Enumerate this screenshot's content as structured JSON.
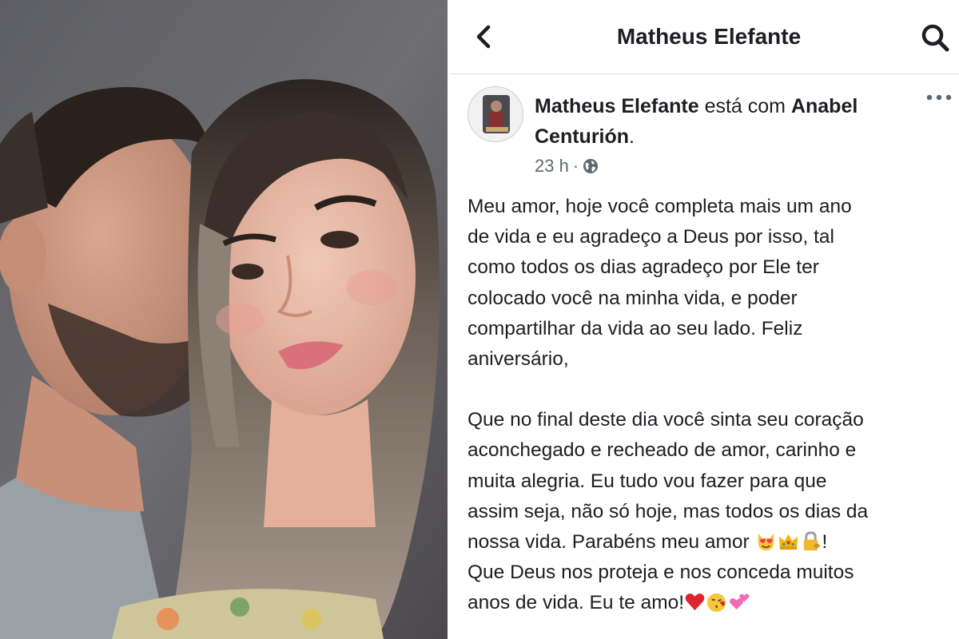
{
  "header": {
    "title": "Matheus Elefante"
  },
  "post": {
    "author": "Matheus Elefante",
    "with_text": "está com",
    "tagged_first": "Anabel",
    "tagged_last": "Centurión",
    "tagged_end": ".",
    "time": "23 h",
    "separator": "·",
    "paragraph1_lines": [
      "Meu amor, hoje você completa mais um ano",
      "de vida e eu agradeço a Deus por isso, tal",
      "como todos os dias agradeço por Ele ter",
      "colocado você na minha vida, e poder",
      "compartilhar da vida ao seu lado. Feliz",
      "aniversário,"
    ],
    "paragraph2_lines": [
      "Que no final deste dia você sinta seu coração",
      "aconchegado e recheado de amor, carinho e",
      "muita alegria. Eu tudo vou fazer para que",
      "assim seja, não só hoje, mas todos os dias da"
    ],
    "line_before_emojis": "nossa vida. Parabéns meu amor ",
    "line_after_emojis": "!",
    "line_next": "Que Deus nos proteja e nos conceda muitos",
    "last_line": "anos de vida. Eu te amo!",
    "emojis_first": [
      "heart-eyes-cat-emoji",
      "crown-emoji",
      "lock-with-key-emoji"
    ],
    "emojis_last": [
      "red-heart-emoji",
      "kissing-face-emoji",
      "two-hearts-emoji"
    ]
  },
  "colors": {
    "text": "#1c1e21",
    "secondary_text": "#606770",
    "separator": "#dadde1"
  },
  "icons": {
    "back": "chevron-left-icon",
    "search": "search-icon",
    "more": "more-options-icon",
    "privacy": "globe-icon"
  }
}
